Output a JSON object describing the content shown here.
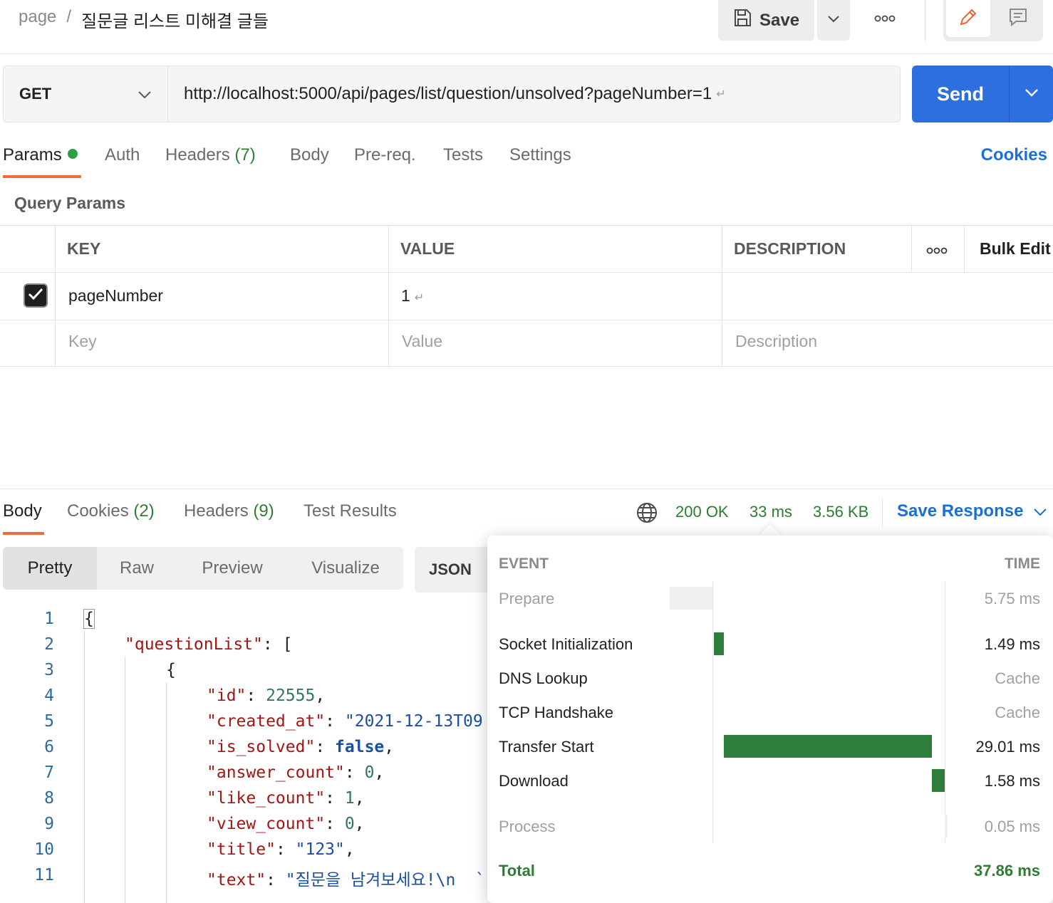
{
  "header": {
    "breadcrumb_parent": "page",
    "breadcrumb_sep": "/",
    "breadcrumb_current": "질문글 리스트 미해결 글들",
    "save_label": "Save"
  },
  "request": {
    "method": "GET",
    "url": "http://localhost:5000/api/pages/list/question/unsolved?pageNumber=1",
    "send_label": "Send",
    "return_glyph": "↵"
  },
  "request_tabs": {
    "params": "Params",
    "auth": "Auth",
    "headers": "Headers",
    "headers_count": "(7)",
    "body": "Body",
    "prereq": "Pre-req.",
    "tests": "Tests",
    "settings": "Settings",
    "cookies": "Cookies"
  },
  "query_params": {
    "title": "Query Params",
    "columns": {
      "key": "KEY",
      "value": "VALUE",
      "description": "DESCRIPTION",
      "bulk_edit": "Bulk Edit"
    },
    "rows": [
      {
        "checked": true,
        "key": "pageNumber",
        "value": "1",
        "description": ""
      }
    ],
    "placeholders": {
      "key": "Key",
      "value": "Value",
      "description": "Description"
    }
  },
  "response_tabs": {
    "body": "Body",
    "cookies": "Cookies",
    "cookies_count": "(2)",
    "headers": "Headers",
    "headers_count": "(9)",
    "test_results": "Test Results"
  },
  "response_stats": {
    "status": "200 OK",
    "time": "33 ms",
    "size": "3.56 KB",
    "save_response": "Save Response"
  },
  "body_format": {
    "modes": [
      "Pretty",
      "Raw",
      "Preview",
      "Visualize"
    ],
    "active": "Pretty",
    "language": "JSON"
  },
  "code": {
    "line_numbers": [
      "1",
      "2",
      "3",
      "4",
      "5",
      "6",
      "7",
      "8",
      "9",
      "10",
      "11"
    ],
    "lines": {
      "l1": "{",
      "l2_key": "\"questionList\"",
      "l2_rest": ": [",
      "l3": "{",
      "l4_key": "\"id\"",
      "l4_val": "22555",
      "l5_key": "\"created_at\"",
      "l5_val": "\"2021-12-13T09",
      "l6_key": "\"is_solved\"",
      "l6_val": "false",
      "l7_key": "\"answer_count\"",
      "l7_val": "0",
      "l8_key": "\"like_count\"",
      "l8_val": "1",
      "l9_key": "\"view_count\"",
      "l9_val": "0",
      "l10_key": "\"title\"",
      "l10_val": "\"123\"",
      "l11_key": "\"text\"",
      "l11_val": "\"질문을 남겨보세요!\\n  `"
    }
  },
  "timing": {
    "event_header": "EVENT",
    "time_header": "TIME",
    "events": [
      {
        "name": "Prepare",
        "time": "5.75 ms"
      },
      {
        "name": "Socket Initialization",
        "time": "1.49 ms"
      },
      {
        "name": "DNS Lookup",
        "time": "Cache"
      },
      {
        "name": "TCP Handshake",
        "time": "Cache"
      },
      {
        "name": "Transfer Start",
        "time": "29.01 ms"
      },
      {
        "name": "Download",
        "time": "1.58 ms"
      },
      {
        "name": "Process",
        "time": "0.05 ms"
      }
    ],
    "total_label": "Total",
    "total_value": "37.86 ms",
    "bar_color": "#2f7d3a"
  },
  "colors": {
    "accent_orange": "#f26b3a",
    "send_blue": "#2e6fe0",
    "link_blue": "#1a6fd8",
    "success_green": "#2e7d32"
  }
}
